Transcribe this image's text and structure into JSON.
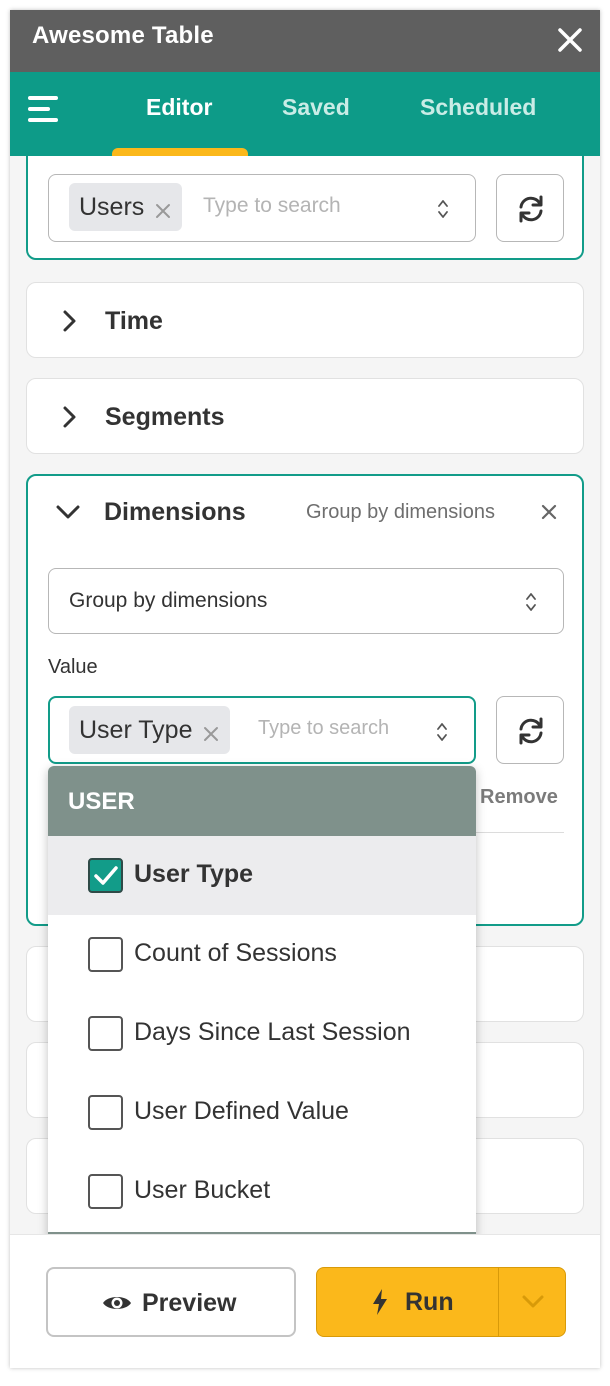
{
  "app": {
    "title": "Awesome Table"
  },
  "nav": {
    "tabs": [
      {
        "label": "Editor",
        "active": true
      },
      {
        "label": "Saved",
        "active": false
      },
      {
        "label": "Scheduled",
        "active": false
      }
    ]
  },
  "source": {
    "chip_label": "Users",
    "placeholder": "Type to search"
  },
  "sections": {
    "time": "Time",
    "segments": "Segments",
    "dimensions": {
      "title": "Dimensions",
      "summary": "Group by dimensions",
      "group_select_value": "Group by dimensions",
      "value_label": "Value",
      "value_chip": "User Type",
      "value_placeholder": "Type to search",
      "remove_label": "Remove"
    }
  },
  "dropdown": {
    "group_header": "USER",
    "items": [
      {
        "label": "User Type",
        "checked": true
      },
      {
        "label": "Count of Sessions",
        "checked": false
      },
      {
        "label": "Days Since Last Session",
        "checked": false
      },
      {
        "label": "User Defined Value",
        "checked": false
      },
      {
        "label": "User Bucket",
        "checked": false
      }
    ]
  },
  "footer": {
    "preview_label": "Preview",
    "run_label": "Run"
  },
  "colors": {
    "titlebar": "#5f5f5f",
    "accent_teal": "#0d9b88",
    "accent_yellow": "#fbb81b",
    "group_header": "#7f918b"
  }
}
